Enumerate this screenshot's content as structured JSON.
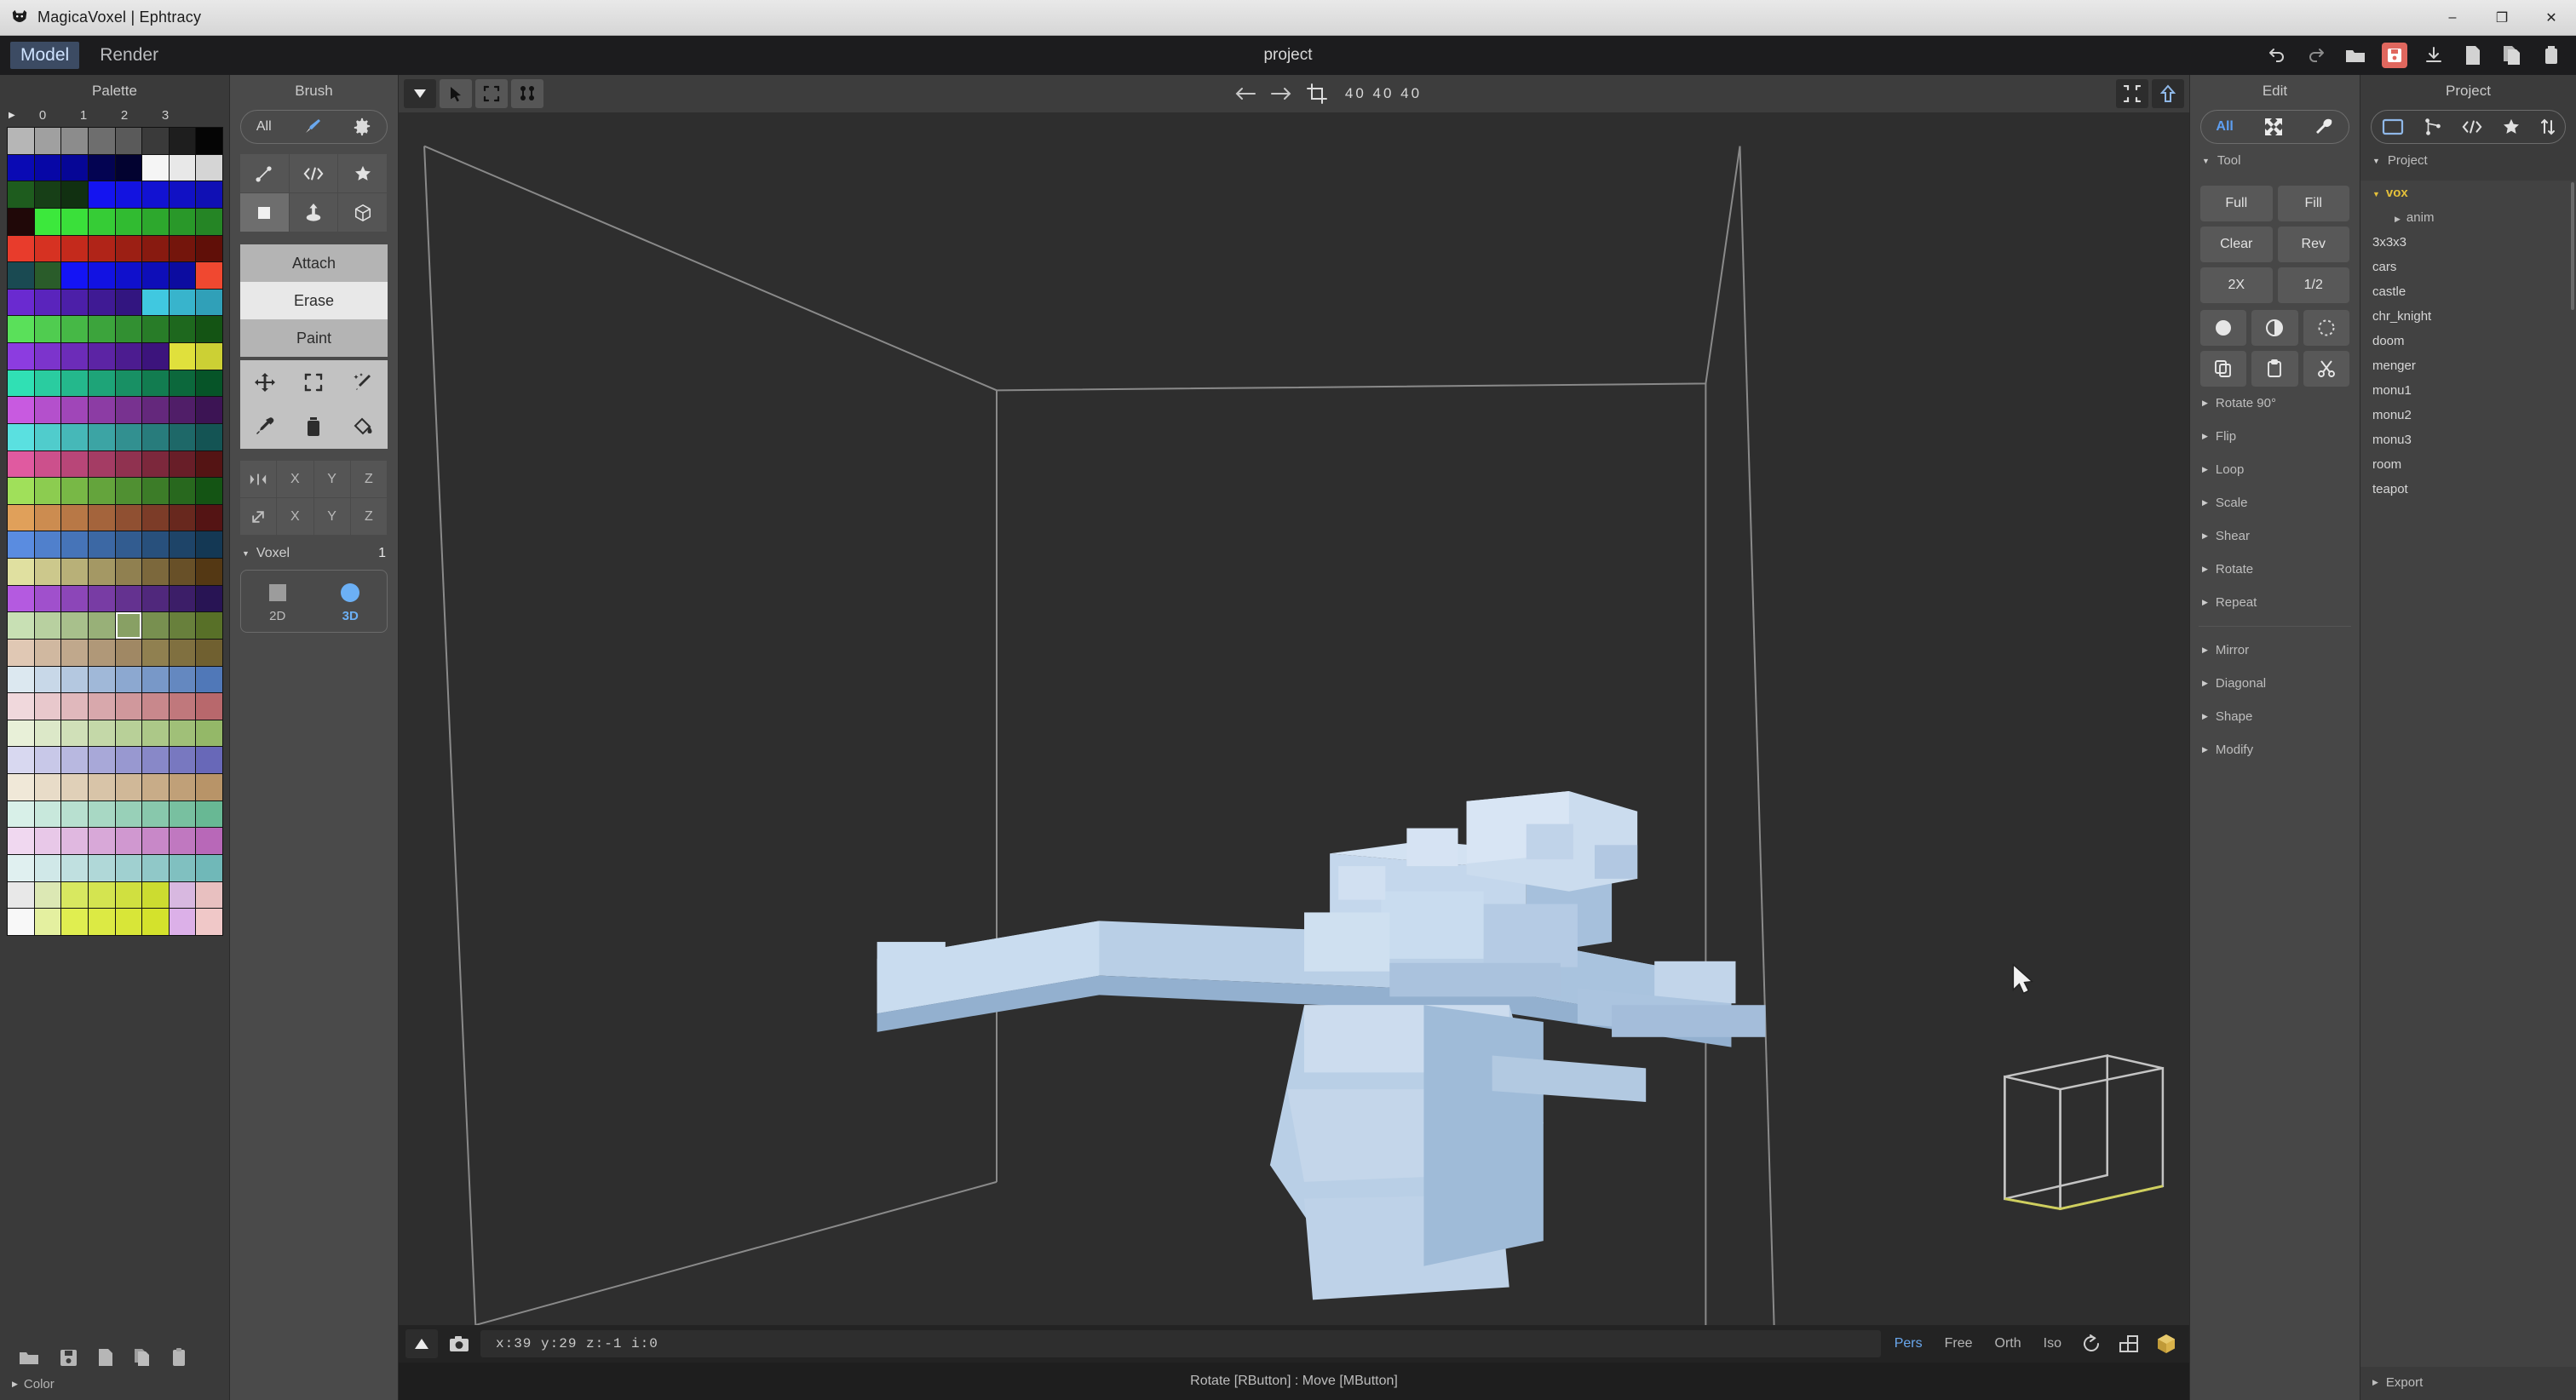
{
  "window": {
    "title": "MagicaVoxel | Ephtracy",
    "buttons": {
      "minimize": "–",
      "maximize": "❐",
      "close": "✕"
    }
  },
  "menu": {
    "items": [
      {
        "label": "Model",
        "active": true
      },
      {
        "label": "Render",
        "active": false
      }
    ],
    "document_title": "project",
    "icons": [
      "undo-icon",
      "redo-icon",
      "open-folder-icon",
      "save-icon",
      "import-icon",
      "new-file-icon",
      "copy-file-icon",
      "trash-icon"
    ]
  },
  "palette": {
    "title": "Palette",
    "column_numbers": [
      "0",
      "1",
      "2",
      "3"
    ],
    "selected_index": 148,
    "colors": [
      "#b6b6b6",
      "#a0a0a0",
      "#8c8c8c",
      "#6e6e6e",
      "#5a5a5a",
      "#3a3a3a",
      "#1e1e1e",
      "#050505",
      "#0a0ab4",
      "#0707a6",
      "#060696",
      "#030352",
      "#020230",
      "#f5f5f5",
      "#e8e8e8",
      "#d5d5d5",
      "#1e5c1e",
      "#173f17",
      "#113011",
      "#1414f0",
      "#1313e0",
      "#1212d2",
      "#1111c4",
      "#1010b4",
      "#200808",
      "#3ce83c",
      "#3ae03a",
      "#36cc36",
      "#31bb31",
      "#2da82d",
      "#299829",
      "#258525",
      "#e83c2c",
      "#d63222",
      "#c42a1c",
      "#b02418",
      "#9c1f14",
      "#881a10",
      "#74150c",
      "#600f08",
      "#1a4a52",
      "#2a5c2a",
      "#1414f5",
      "#1212e2",
      "#1010cc",
      "#0e0eb8",
      "#0c0ca0",
      "#f04830",
      "#6a2ad0",
      "#5a24bc",
      "#4c1fa8",
      "#3f1a94",
      "#321580",
      "#40c8e0",
      "#38b4cc",
      "#30a0b8",
      "#5ae05a",
      "#50cc50",
      "#46b846",
      "#3ca43c",
      "#329032",
      "#287c28",
      "#1e681e",
      "#145414",
      "#8c3ce0",
      "#7c34cc",
      "#6c2cb8",
      "#5c24a4",
      "#4c1c90",
      "#3c147c",
      "#e0e03c",
      "#ccd034",
      "#30e0b4",
      "#2accA0",
      "#24b88c",
      "#1ea478",
      "#189064",
      "#127c50",
      "#0c683c",
      "#065428",
      "#c85ae0",
      "#b450cc",
      "#a046b8",
      "#8c3ca4",
      "#783290",
      "#64287c",
      "#501e68",
      "#3c1454",
      "#5ae0e0",
      "#50cccc",
      "#46b8b8",
      "#3ca4a4",
      "#329090",
      "#287c7c",
      "#1e6868",
      "#145454",
      "#e05aa0",
      "#cc508c",
      "#b84678",
      "#a43c64",
      "#903250",
      "#7c283c",
      "#681e28",
      "#541414",
      "#a0e05a",
      "#8ccc50",
      "#78b846",
      "#64a43c",
      "#509032",
      "#3c7c28",
      "#28681e",
      "#145414",
      "#e0a05a",
      "#cc8c50",
      "#b87846",
      "#a4643c",
      "#905032",
      "#7c3c28",
      "#68281e",
      "#541414",
      "#5a8ce0",
      "#5080cc",
      "#4674b8",
      "#3c68a4",
      "#325c90",
      "#28507c",
      "#1e4468",
      "#143854",
      "#e0e0a0",
      "#ccc88c",
      "#b8b078",
      "#a49864",
      "#908050",
      "#7c683c",
      "#685028",
      "#543814",
      "#b45ae0",
      "#a050cc",
      "#8c46b8",
      "#783ca4",
      "#643290",
      "#50287c",
      "#3c1e68",
      "#281454",
      "#c8e0b4",
      "#b8d0a0",
      "#a8c08c",
      "#98b078",
      "#88a064",
      "#789050",
      "#68803c",
      "#587028",
      "#e0c8b4",
      "#d0b8a0",
      "#c0a88c",
      "#b09878",
      "#a08864",
      "#908050",
      "#807040",
      "#706030",
      "#dce8f0",
      "#c8d8e8",
      "#b4c8e0",
      "#a0b8d8",
      "#8ca8d0",
      "#7898c8",
      "#6488c0",
      "#5078b8",
      "#f0d8dc",
      "#e8c8cc",
      "#e0b8bc",
      "#d8a8ac",
      "#d0989c",
      "#c8888c",
      "#c0787c",
      "#b8686c",
      "#e8f0d8",
      "#dce8c8",
      "#d0e0b8",
      "#c4d8a8",
      "#b8d098",
      "#acc888",
      "#a0c078",
      "#94b868",
      "#d8d8f0",
      "#c8c8e8",
      "#b8b8e0",
      "#a8a8d8",
      "#9898d0",
      "#8888c8",
      "#7878c0",
      "#6868b8",
      "#f0e8d8",
      "#e8dcc8",
      "#e0d0b8",
      "#d8c4a8",
      "#d0b898",
      "#c8ac88",
      "#c0a078",
      "#b89468",
      "#d8f0e8",
      "#c8e8dc",
      "#b8e0d0",
      "#a8d8c4",
      "#98d0b8",
      "#88c8ac",
      "#78c0a0",
      "#68b894",
      "#f0d8f0",
      "#e8c8e8",
      "#e0b8e0",
      "#d8a8d8",
      "#d098d0",
      "#c888c8",
      "#c078c0",
      "#b868b8",
      "#e0f0f0",
      "#d0e8e8",
      "#c0e0e0",
      "#b0d8d8",
      "#a0d0d0",
      "#90c8c8",
      "#80c0c0",
      "#70b8b8",
      "#e8e8e8",
      "#dce8b4",
      "#d8e860",
      "#d4e450",
      "#d0e040",
      "#ccdc30",
      "#d8b8e0",
      "#e8c0c0",
      "#f8f8f8",
      "#e4f0a0",
      "#e0ee50",
      "#dcea44",
      "#d8e638",
      "#d4e22c",
      "#dcb0e8",
      "#f0c8c8"
    ],
    "file_icons": [
      "open-palette-icon",
      "save-palette-icon",
      "new-palette-icon",
      "copy-palette-icon",
      "paste-palette-icon"
    ],
    "color_section": {
      "label": "Color",
      "expanded": false
    }
  },
  "brush": {
    "title": "Brush",
    "mode_pill": {
      "label": "All",
      "icons": [
        "brush-icon",
        "gear-icon"
      ]
    },
    "shape_tools": [
      {
        "name": "line-tool-icon",
        "active": false
      },
      {
        "name": "pattern-tool-icon",
        "active": false
      },
      {
        "name": "star-tool-icon",
        "active": false
      },
      {
        "name": "voxel-tool-icon",
        "active": true
      },
      {
        "name": "face-tool-icon",
        "active": false
      },
      {
        "name": "box-tool-icon",
        "active": false
      }
    ],
    "actions": [
      {
        "label": "Attach",
        "state": "mid"
      },
      {
        "label": "Erase",
        "state": "selected"
      },
      {
        "label": "Paint",
        "state": "normal"
      }
    ],
    "transform_tools": [
      "move-icon",
      "select-region-icon",
      "magic-wand-icon",
      "eyedropper-icon",
      "trash-icon",
      "bucket-fill-icon"
    ],
    "mirror_rows": [
      {
        "icon": "mirror-icon",
        "axes": [
          "X",
          "Y",
          "Z"
        ]
      },
      {
        "icon": "diagonal-icon",
        "axes": [
          "X",
          "Y",
          "Z"
        ]
      }
    ],
    "voxel_section": {
      "label": "Voxel",
      "value": "1",
      "expanded": true
    },
    "dimension_modes": [
      {
        "label": "2D",
        "active": false
      },
      {
        "label": "3D",
        "active": true
      }
    ]
  },
  "viewport": {
    "toolbar": {
      "left_icons": [
        {
          "name": "dropdown-arrow-icon",
          "dark": true
        },
        {
          "name": "cursor-select-icon",
          "dark": false
        },
        {
          "name": "marquee-select-icon",
          "dark": false
        },
        {
          "name": "multi-select-icon",
          "dark": false
        }
      ],
      "nav_icons": [
        "prev-frame-icon",
        "next-frame-icon",
        "crop-icon"
      ],
      "dimensions": "40  40  40",
      "right_icons": [
        "fit-view-icon",
        "up-arrow-icon"
      ]
    },
    "status": {
      "play_icon": "play-icon",
      "camera_icon": "camera-icon",
      "coordinates": "x:39   y:29   z:-1   i:0",
      "camera_modes": [
        {
          "label": "Pers",
          "active": true
        },
        {
          "label": "Free",
          "active": false
        },
        {
          "label": "Orth",
          "active": false
        },
        {
          "label": "Iso",
          "active": false
        }
      ],
      "view_icons": [
        "rotate-view-icon",
        "grid-view-icon",
        "shade-view-icon"
      ]
    },
    "hint": "Rotate [RButton] : Move [MButton]"
  },
  "edit": {
    "title": "Edit",
    "mode_pill": {
      "label": "All",
      "icons": [
        "expand-icon",
        "wrench-icon"
      ]
    },
    "tool_section": {
      "label": "Tool",
      "expanded": true
    },
    "buttons": [
      "Full",
      "Fill",
      "Clear",
      "Rev",
      "2X",
      "1/2"
    ],
    "icon_buttons": [
      "circle-solid-icon",
      "contrast-icon",
      "circle-dashed-icon",
      "copy-icon",
      "paste-icon",
      "cut-icon"
    ],
    "accordions": [
      "Rotate 90°",
      "Flip",
      "Loop",
      "Scale",
      "Shear",
      "Rotate",
      "Repeat",
      "Mirror",
      "Diagonal",
      "Shape",
      "Modify"
    ]
  },
  "project": {
    "title": "Project",
    "tab_icons": [
      {
        "name": "folder-icon",
        "active": true
      },
      {
        "name": "node-graph-icon",
        "active": false
      },
      {
        "name": "code-icon",
        "active": false
      },
      {
        "name": "star-icon",
        "active": false
      },
      {
        "name": "sort-icon",
        "active": false
      }
    ],
    "section": {
      "label": "Project",
      "expanded": true
    },
    "tree": [
      {
        "label": "vox",
        "type": "folder-open",
        "depth": 0
      },
      {
        "label": "anim",
        "type": "folder-closed",
        "depth": 1
      },
      {
        "label": "3x3x3",
        "type": "file",
        "depth": 0
      },
      {
        "label": "cars",
        "type": "file",
        "depth": 0
      },
      {
        "label": "castle",
        "type": "file",
        "depth": 0
      },
      {
        "label": "chr_knight",
        "type": "file",
        "depth": 0
      },
      {
        "label": "doom",
        "type": "file",
        "depth": 0
      },
      {
        "label": "menger",
        "type": "file",
        "depth": 0
      },
      {
        "label": "monu1",
        "type": "file",
        "depth": 0
      },
      {
        "label": "monu2",
        "type": "file",
        "depth": 0
      },
      {
        "label": "monu3",
        "type": "file",
        "depth": 0
      },
      {
        "label": "room",
        "type": "file",
        "depth": 0
      },
      {
        "label": "teapot",
        "type": "file",
        "depth": 0
      }
    ],
    "export": {
      "label": "Export",
      "expanded": false
    }
  },
  "colors": {
    "accent_blue": "#5e9ff2",
    "accent_yellow": "#e4c03a",
    "save_red": "#e0675e",
    "model_voxel": "#b9cfe6",
    "viewport_bg": "#2e2e2e"
  }
}
